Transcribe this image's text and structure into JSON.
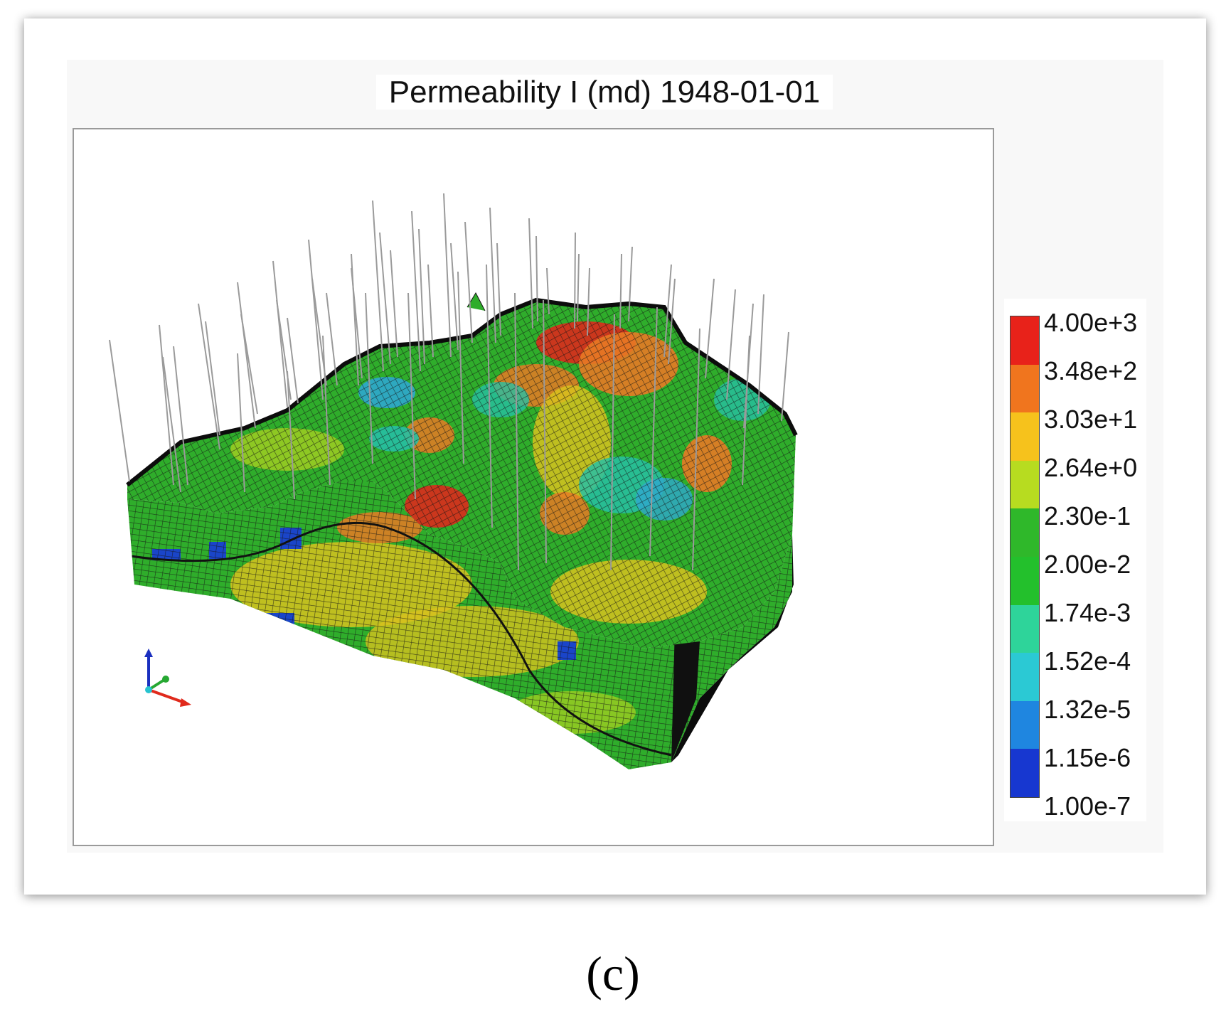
{
  "title": "Permeability I (md) 1948-01-01",
  "caption": "(c)",
  "legend": {
    "labels": [
      "4.00e+3",
      "3.48e+2",
      "3.03e+1",
      "2.64e+0",
      "2.30e-1",
      "2.00e-2",
      "1.74e-3",
      "1.52e-4",
      "1.32e-5",
      "1.15e-6",
      "1.00e-7"
    ],
    "colors": [
      "#e8221a",
      "#f0751e",
      "#f6c21c",
      "#b7dc20",
      "#2fb82a",
      "#23c02c",
      "#2ed49a",
      "#2bc9d4",
      "#1f86e0",
      "#1737d0"
    ]
  },
  "palette": {
    "red": "#dd2a1c",
    "orange": "#e87a25",
    "yellow": "#d8c21e",
    "lime": "#9fcd22",
    "green": "#2fad2b",
    "teal": "#27bfa4",
    "cyan": "#2fa7cf",
    "blue": "#1a45c9",
    "grid_line": "#1b1b1b",
    "well_line": "#9a9a9a"
  }
}
